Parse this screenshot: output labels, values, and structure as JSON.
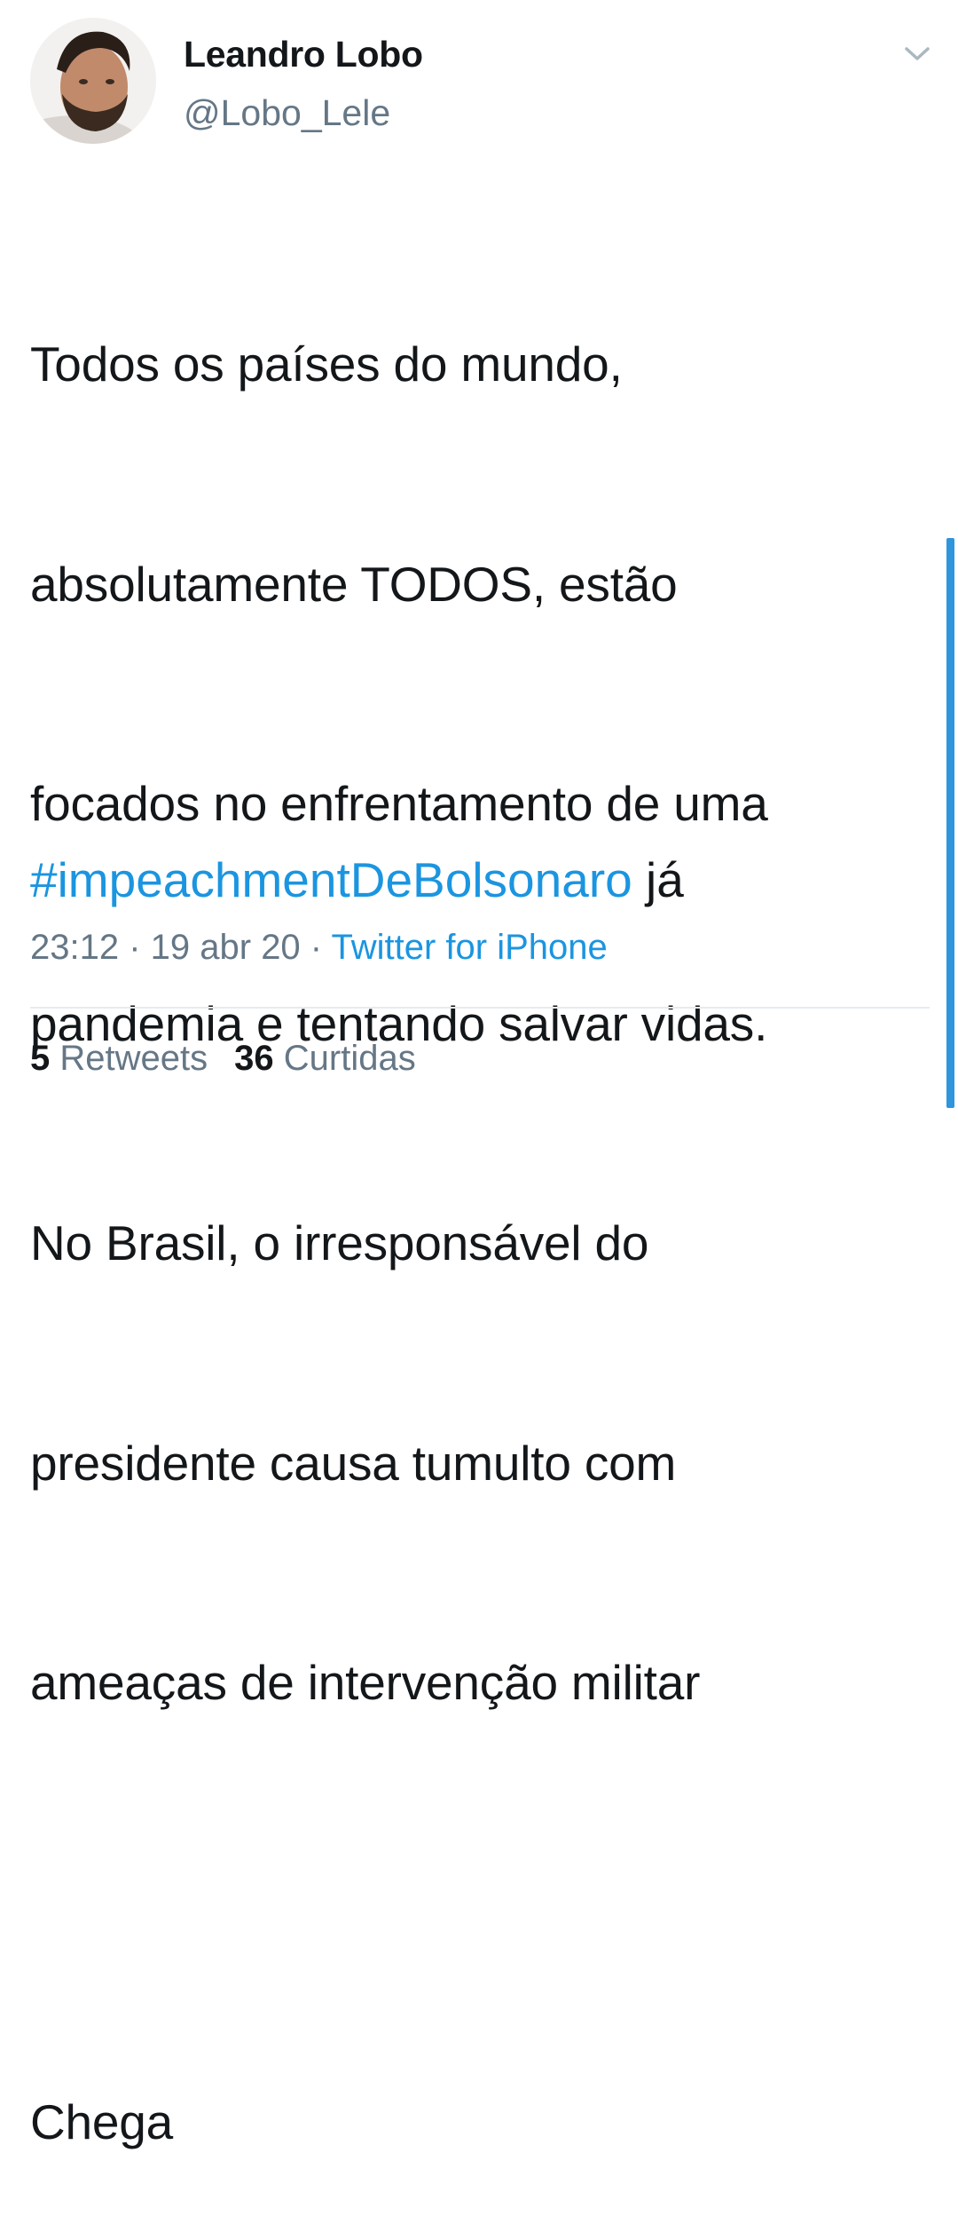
{
  "author": {
    "display_name": "Leandro Lobo",
    "handle": "@Lobo_Lele"
  },
  "tweet": {
    "lines": [
      "Todos os países do mundo,",
      "absolutamente TODOS, estão",
      "focados no enfrentamento de uma",
      "pandemia e tentando salvar vidas.",
      "No Brasil, o irresponsável do",
      "presidente causa tumulto com",
      "ameaças de intervenção militar",
      "",
      "Chega"
    ],
    "hashtag": "#impeachmentDeBolsonaro",
    "after_hashtag": " já"
  },
  "meta": {
    "time": "23:12",
    "separator": " · ",
    "date": "19 abr 20",
    "source": "Twitter for iPhone"
  },
  "stats": {
    "retweets_count": "5",
    "retweets_label": "Retweets",
    "likes_count": "36",
    "likes_label": "Curtidas"
  },
  "colors": {
    "link": "#1b95e0",
    "secondary_text": "#657786",
    "primary_text": "#14171a"
  },
  "icons": {
    "caret": "chevron-down-icon"
  }
}
